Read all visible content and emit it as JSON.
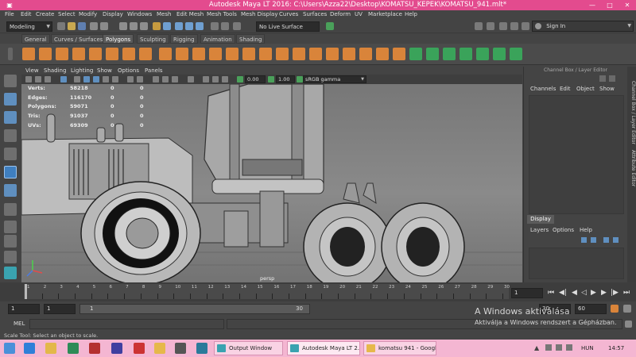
{
  "window": {
    "title": "Autodesk Maya LT 2016: C:\\Users\\Azza22\\Desktop\\KOMATSU_KEPEK\\KOMATSU_941.mlt*",
    "minimize": "—",
    "maximize": "□",
    "close": "✕",
    "titlebar_color": "#e34b8e"
  },
  "menubar": [
    "File",
    "Edit",
    "Create",
    "Select",
    "Modify",
    "Display",
    "Windows",
    "Mesh",
    "Edit Mesh",
    "Mesh Tools",
    "Mesh Display",
    "Curves",
    "Surfaces",
    "Deform",
    "UV",
    "Marketplace",
    "Help"
  ],
  "status_line": {
    "mode": "Modeling",
    "live_surface": "No Live Surface",
    "sign_in": "Sign In"
  },
  "shelf_tabs": [
    {
      "label": "General",
      "active": false
    },
    {
      "label": "Curves / Surfaces",
      "active": false
    },
    {
      "label": "Polygons",
      "active": true
    },
    {
      "label": "Sculpting",
      "active": false
    },
    {
      "label": "Rigging",
      "active": false
    },
    {
      "label": "Animation",
      "active": false
    },
    {
      "label": "Shading",
      "active": false
    }
  ],
  "viewport_menu": [
    "View",
    "Shading",
    "Lighting",
    "Show",
    "Options",
    "Panels"
  ],
  "viewport_bar": {
    "exposure": "0.00",
    "gamma": "1.00",
    "color_space": "sRGB gamma"
  },
  "hud": [
    {
      "label": "Verts:",
      "v1": "58218",
      "v2": "0",
      "v3": "0"
    },
    {
      "label": "Edges:",
      "v1": "116170",
      "v2": "0",
      "v3": "0"
    },
    {
      "label": "Polygons:",
      "v1": "59071",
      "v2": "0",
      "v3": "0"
    },
    {
      "label": "Tris:",
      "v1": "91037",
      "v2": "0",
      "v3": "0"
    },
    {
      "label": "UVs:",
      "v1": "69309",
      "v2": "0",
      "v3": "0"
    }
  ],
  "camera_label": "persp",
  "channel_box": {
    "title": "Channel Box / Layer Editor",
    "menu": [
      "Channels",
      "Edit",
      "Object",
      "Show"
    ],
    "display_tab": "Display",
    "layer_menu": [
      "Layers",
      "Options",
      "Help"
    ]
  },
  "side_tabs": [
    "Channel Box / Layer Editor",
    "Attribute Editor"
  ],
  "time_slider": {
    "ticks": [
      "1",
      "2",
      "3",
      "4",
      "5",
      "6",
      "7",
      "8",
      "9",
      "10",
      "11",
      "12",
      "13",
      "14",
      "15",
      "16",
      "17",
      "18",
      "19",
      "20",
      "21",
      "22",
      "23",
      "24",
      "25",
      "26",
      "27",
      "28",
      "29",
      "30"
    ],
    "current_frame": "1"
  },
  "range": {
    "start": "1",
    "anim_start": "1",
    "slider_start": "1",
    "slider_end": "30",
    "end": "30",
    "anim_end": "60"
  },
  "mel": {
    "label": "MEL"
  },
  "help_line": "Scale Tool: Select an object to scale.",
  "watermark": {
    "line1": "A Windows aktiválása",
    "line2": "Aktiválja a Windows rendszert a Gépházban."
  },
  "taskbar": {
    "buttons": [
      {
        "label": "Output Window",
        "active": false
      },
      {
        "label": "Autodesk Maya LT 2...",
        "active": true
      },
      {
        "label": "komatsu 941 - Googl...",
        "active": false
      }
    ],
    "language": "HUN",
    "time": "14:57",
    "color": "#f4b6d2"
  }
}
